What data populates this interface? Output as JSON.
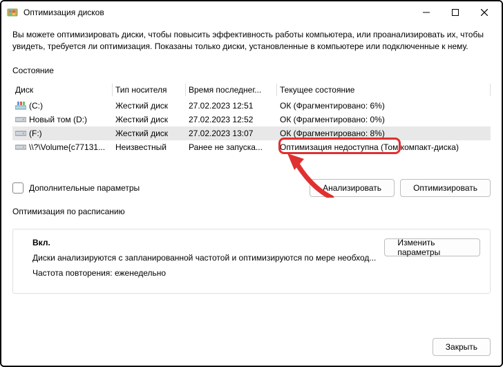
{
  "titlebar": {
    "title": "Оптимизация дисков"
  },
  "description": "Вы можете оптимизировать диски, чтобы повысить эффективность работы  компьютера, или проанализировать их, чтобы увидеть, требуется ли оптимизация. Показаны только диски, установленные в компьютере или подключенные к нему.",
  "section_state": "Состояние",
  "columns": {
    "disk": "Диск",
    "media": "Тип носителя",
    "last": "Время последнег...",
    "state": "Текущее состояние"
  },
  "rows": [
    {
      "icon": "os",
      "name": "(C:)",
      "media": "Жесткий диск",
      "last": "27.02.2023 12:51",
      "state": "ОК (Фрагментировано: 6%)"
    },
    {
      "icon": "hdd",
      "name": "Новый том (D:)",
      "media": "Жесткий диск",
      "last": "27.02.2023 12:52",
      "state": "ОК (Фрагментировано: 0%)"
    },
    {
      "icon": "hdd",
      "name": "(F:)",
      "media": "Жесткий диск",
      "last": "27.02.2023 13:07",
      "state": "ОК (Фрагментировано: 8%)"
    },
    {
      "icon": "hdd",
      "name": "\\\\?\\Volume{c77131...",
      "media": "Неизвестный",
      "last": "Ранее не запуска...",
      "state": "Оптимизация недоступна (Том компакт-диска)"
    }
  ],
  "advanced_label": "Дополнительные параметры",
  "buttons": {
    "analyze": "Анализировать",
    "optimize": "Оптимизировать",
    "change": "Изменить параметры",
    "close": "Закрыть"
  },
  "schedule_label": "Оптимизация по расписанию",
  "schedule": {
    "on": "Вкл.",
    "line1": "Диски анализируются с запланированной частотой и оптимизируются по мере необход...",
    "line2": "Частота повторения: еженедельно"
  }
}
